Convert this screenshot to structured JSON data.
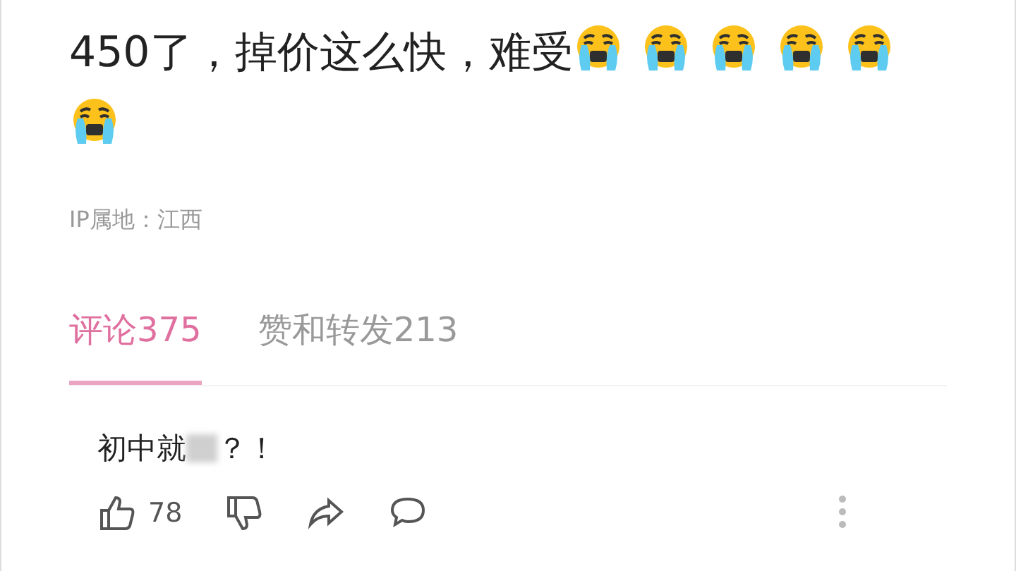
{
  "post": {
    "text": "450了，掉价这么快，难受",
    "emojis": [
      {
        "kind": "crying"
      },
      {
        "kind": "crying"
      },
      {
        "kind": "crying"
      },
      {
        "kind": "crying"
      },
      {
        "kind": "crying"
      },
      {
        "kind": "crying"
      }
    ],
    "ip_location": "IP属地：江西"
  },
  "tabs": [
    {
      "label": "评论375",
      "selected": true
    },
    {
      "label": "赞和转发213",
      "selected": false
    }
  ],
  "comment": {
    "text_before": "初中就",
    "redacted": true,
    "text_after": "？！",
    "likes": "78"
  }
}
